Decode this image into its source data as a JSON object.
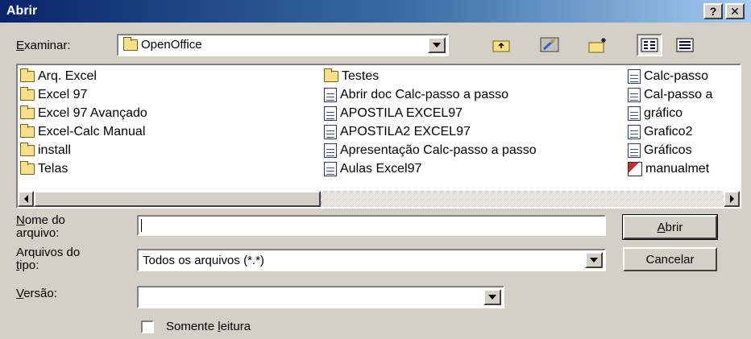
{
  "window": {
    "title": "Abrir",
    "help_label": "?",
    "close_label": "✕"
  },
  "look_in": {
    "label": "Examinar:",
    "mnemonic": "E",
    "rest": "xaminar:",
    "value": "OpenOffice"
  },
  "toolbar": {
    "up_folder": "up-folder-icon",
    "desktop": "desktop-icon",
    "new_folder": "new-folder-icon",
    "list_view": "list-view-icon",
    "details_view": "details-view-icon"
  },
  "files": {
    "col1": [
      {
        "type": "folder",
        "name": "Arq. Excel"
      },
      {
        "type": "folder",
        "name": "Excel 97"
      },
      {
        "type": "folder",
        "name": "Excel 97 Avançado"
      },
      {
        "type": "folder",
        "name": "Excel-Calc Manual"
      },
      {
        "type": "folder",
        "name": "install"
      },
      {
        "type": "folder",
        "name": "Telas"
      }
    ],
    "col2": [
      {
        "type": "folder",
        "name": "Testes"
      },
      {
        "type": "doc",
        "name": "Abrir doc Calc-passo a passo"
      },
      {
        "type": "doc",
        "name": "APOSTILA EXCEL97"
      },
      {
        "type": "doc",
        "name": "APOSTILA2 EXCEL97"
      },
      {
        "type": "doc",
        "name": "Apresentação Calc-passo a passo"
      },
      {
        "type": "doc",
        "name": "Aulas Excel97"
      }
    ],
    "col3": [
      {
        "type": "doc",
        "name": "Calc-passo"
      },
      {
        "type": "doc",
        "name": "Cal-passo a"
      },
      {
        "type": "doc",
        "name": "gráfico"
      },
      {
        "type": "doc",
        "name": "Grafico2"
      },
      {
        "type": "doc",
        "name": "Gráficos"
      },
      {
        "type": "pic",
        "name": "manualmet"
      }
    ]
  },
  "filename": {
    "label_mnemonic": "N",
    "label_line1_rest": "ome do",
    "label_line2": "arquivo:",
    "value": ""
  },
  "filetype": {
    "label_line1": "Arquivos do",
    "label_line2_mnemonic": "t",
    "label_line2_rest": "ipo:",
    "value": "Todos os arquivos (*.*)"
  },
  "version": {
    "label_mnemonic": "V",
    "label_rest": "ersão:",
    "value": ""
  },
  "readonly": {
    "label_pre": "Somente ",
    "label_mnemonic": "l",
    "label_post": "eitura",
    "checked": false
  },
  "buttons": {
    "open_mnemonic": "A",
    "open_rest": "brir",
    "cancel": "Cancelar"
  }
}
